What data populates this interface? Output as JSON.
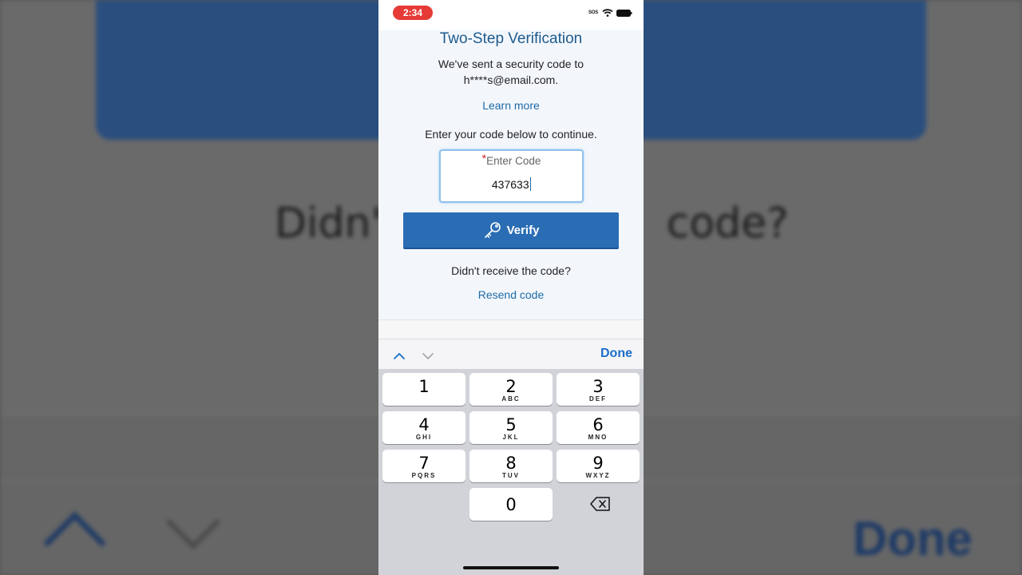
{
  "status_bar": {
    "time": "2:34",
    "sos": "SOS"
  },
  "verification": {
    "title": "Two-Step Verification",
    "message_line1": "We've sent a security code to",
    "message_line2": "h****s@email.com.",
    "learn_more": "Learn more",
    "instruction": "Enter your code below to continue.",
    "code_label": "Enter Code",
    "required_marker": "*",
    "code_value": "437633",
    "verify_label": "Verify",
    "didnt_receive": "Didn't receive the code?",
    "resend": "Resend code"
  },
  "keyboard": {
    "done_label": "Done",
    "keys": [
      {
        "num": "1",
        "letters": ""
      },
      {
        "num": "2",
        "letters": "ABC"
      },
      {
        "num": "3",
        "letters": "DEF"
      },
      {
        "num": "4",
        "letters": "GHI"
      },
      {
        "num": "5",
        "letters": "JKL"
      },
      {
        "num": "6",
        "letters": "MNO"
      },
      {
        "num": "7",
        "letters": "PQRS"
      },
      {
        "num": "8",
        "letters": "TUV"
      },
      {
        "num": "9",
        "letters": "WXYZ"
      },
      {
        "num": "0",
        "letters": ""
      }
    ]
  },
  "background": {
    "text_left": "Didn'",
    "text_right": "code?",
    "done_label": "Done"
  },
  "colors": {
    "accent": "#2a6db4",
    "link": "#1e6aa6",
    "title": "#1e5a8c",
    "time_pill": "#e63a36",
    "required": "#d0202a"
  }
}
